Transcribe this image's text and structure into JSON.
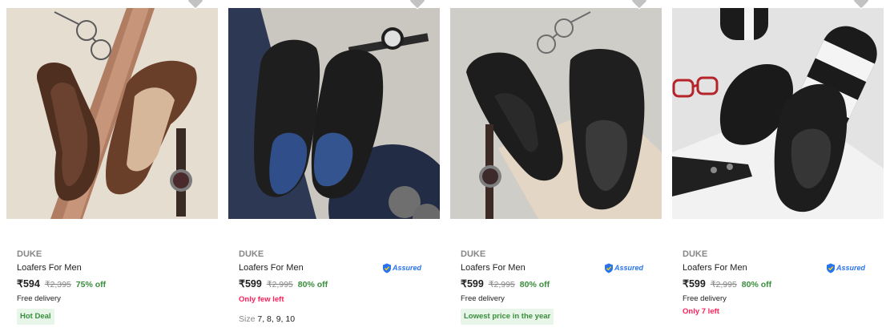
{
  "colors": {
    "accent_green": "#388e3c",
    "assured_blue": "#2874f0",
    "urgent_pink": "#ff1f59",
    "muted_grey": "#878787"
  },
  "icons": {
    "wishlist": "heart-icon",
    "assured": "assured-shield-icon"
  },
  "products": [
    {
      "brand": "DUKE",
      "title": "Loafers For Men",
      "price": "₹594",
      "mrp": "₹2,395",
      "off": "75% off",
      "delivery": "Free delivery",
      "badge": "Hot Deal"
    },
    {
      "brand": "DUKE",
      "title": "Loafers For Men",
      "assured": "Assured",
      "price": "₹599",
      "mrp": "₹2,995",
      "off": "80% off",
      "stock": "Only few left",
      "size_label": "Size",
      "sizes": "7, 8, 9, 10"
    },
    {
      "brand": "DUKE",
      "title": "Loafers For Men",
      "assured": "Assured",
      "price": "₹599",
      "mrp": "₹2,995",
      "off": "80% off",
      "delivery": "Free delivery",
      "badge": "Lowest price in the year"
    },
    {
      "brand": "DUKE",
      "title": "Loafers For Men",
      "assured": "Assured",
      "price": "₹599",
      "mrp": "₹2,995",
      "off": "80% off",
      "delivery": "Free delivery",
      "stock": "Only 7 left"
    }
  ]
}
